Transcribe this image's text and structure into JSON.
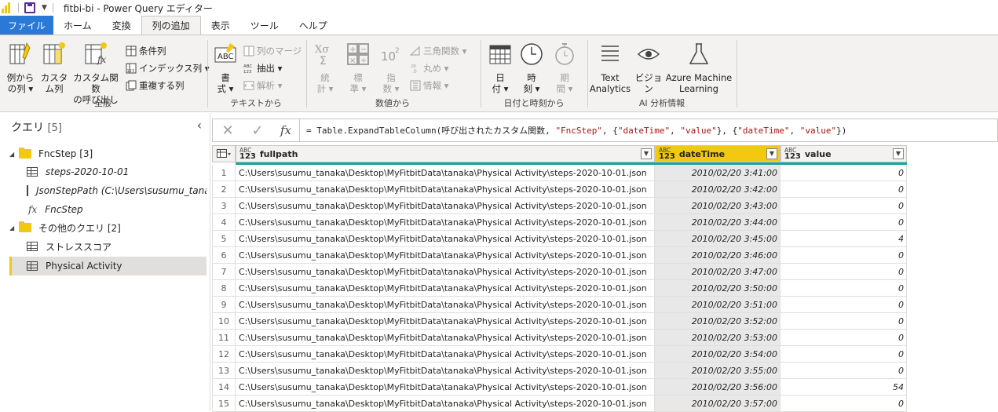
{
  "app": {
    "title": "fitbi-bi - Power Query エディター"
  },
  "tabs": [
    "ファイル",
    "ホーム",
    "変換",
    "列の追加",
    "表示",
    "ツール",
    "ヘルプ"
  ],
  "ribbon": {
    "general": {
      "label": "全般",
      "col_from_examples": [
        "例から",
        "の列 ▾"
      ],
      "custom_col": [
        "カスタ",
        "ム列"
      ],
      "invoke_custom_fn": [
        "カスタム関数",
        "の呼び出し"
      ],
      "conditional_col": "条件列",
      "index_col": "インデックス列 ▾",
      "duplicate_col": "重複する列"
    },
    "text": {
      "label": "テキストから",
      "format": [
        "書",
        "式 ▾"
      ],
      "merge_cols": "列のマージ",
      "extract": "抽出 ▾",
      "parse": "解析 ▾"
    },
    "number": {
      "label": "数値から",
      "statistics": [
        "統",
        "計 ▾"
      ],
      "standard": [
        "標",
        "準 ▾"
      ],
      "scientific": [
        "指",
        "数 ▾"
      ],
      "trig": "三角関数 ▾",
      "rounding": "丸め ▾",
      "information": "情報 ▾"
    },
    "datetime": {
      "label": "日付と時刻から",
      "date": [
        "日",
        "付 ▾"
      ],
      "time": [
        "時",
        "刻 ▾"
      ],
      "duration": [
        "期",
        "間 ▾"
      ]
    },
    "ai": {
      "label": "AI 分析情報",
      "text_analytics": [
        "Text",
        "Analytics"
      ],
      "vision": [
        "ビジョ",
        "ン"
      ],
      "azure_ml": [
        "Azure Machine",
        "Learning"
      ]
    }
  },
  "queries": {
    "header": "クエリ",
    "count": "[5]",
    "groups": [
      {
        "name": "FncStep [3]"
      },
      {
        "name": "その他のクエリ [2]"
      }
    ],
    "items": [
      "steps-2020-10-01",
      "JsonStepPath (C:\\Users\\susumu_tanaka",
      "FncStep",
      "ストレススコア",
      "Physical Activity"
    ]
  },
  "formula": {
    "prefix": "= Table.ExpandTableColumn(呼び出されたカスタム関数, ",
    "s1": "\"FncStep\"",
    "mid1": ", {",
    "s2": "\"dateTime\"",
    "mid2": ", ",
    "s3": "\"value\"",
    "mid3": "}, {",
    "s4": "\"dateTime\"",
    "mid4": ", ",
    "s5": "\"value\"",
    "suffix": "})"
  },
  "grid": {
    "columns": [
      {
        "name": "fullpath",
        "type_top": "ABC",
        "type_bottom": "123"
      },
      {
        "name": "dateTime",
        "type_top": "ABC",
        "type_bottom": "123"
      },
      {
        "name": "value",
        "type_top": "ABC",
        "type_bottom": "123"
      }
    ],
    "rows": [
      [
        "1",
        "C:\\Users\\susumu_tanaka\\Desktop\\MyFitbitData\\tanaka\\Physical Activity\\steps-2020-10-01.json",
        "2010/02/20 3:41:00",
        "0"
      ],
      [
        "2",
        "C:\\Users\\susumu_tanaka\\Desktop\\MyFitbitData\\tanaka\\Physical Activity\\steps-2020-10-01.json",
        "2010/02/20 3:42:00",
        "0"
      ],
      [
        "3",
        "C:\\Users\\susumu_tanaka\\Desktop\\MyFitbitData\\tanaka\\Physical Activity\\steps-2020-10-01.json",
        "2010/02/20 3:43:00",
        "0"
      ],
      [
        "4",
        "C:\\Users\\susumu_tanaka\\Desktop\\MyFitbitData\\tanaka\\Physical Activity\\steps-2020-10-01.json",
        "2010/02/20 3:44:00",
        "0"
      ],
      [
        "5",
        "C:\\Users\\susumu_tanaka\\Desktop\\MyFitbitData\\tanaka\\Physical Activity\\steps-2020-10-01.json",
        "2010/02/20 3:45:00",
        "4"
      ],
      [
        "6",
        "C:\\Users\\susumu_tanaka\\Desktop\\MyFitbitData\\tanaka\\Physical Activity\\steps-2020-10-01.json",
        "2010/02/20 3:46:00",
        "0"
      ],
      [
        "7",
        "C:\\Users\\susumu_tanaka\\Desktop\\MyFitbitData\\tanaka\\Physical Activity\\steps-2020-10-01.json",
        "2010/02/20 3:47:00",
        "0"
      ],
      [
        "8",
        "C:\\Users\\susumu_tanaka\\Desktop\\MyFitbitData\\tanaka\\Physical Activity\\steps-2020-10-01.json",
        "2010/02/20 3:50:00",
        "0"
      ],
      [
        "9",
        "C:\\Users\\susumu_tanaka\\Desktop\\MyFitbitData\\tanaka\\Physical Activity\\steps-2020-10-01.json",
        "2010/02/20 3:51:00",
        "0"
      ],
      [
        "10",
        "C:\\Users\\susumu_tanaka\\Desktop\\MyFitbitData\\tanaka\\Physical Activity\\steps-2020-10-01.json",
        "2010/02/20 3:52:00",
        "0"
      ],
      [
        "11",
        "C:\\Users\\susumu_tanaka\\Desktop\\MyFitbitData\\tanaka\\Physical Activity\\steps-2020-10-01.json",
        "2010/02/20 3:53:00",
        "0"
      ],
      [
        "12",
        "C:\\Users\\susumu_tanaka\\Desktop\\MyFitbitData\\tanaka\\Physical Activity\\steps-2020-10-01.json",
        "2010/02/20 3:54:00",
        "0"
      ],
      [
        "13",
        "C:\\Users\\susumu_tanaka\\Desktop\\MyFitbitData\\tanaka\\Physical Activity\\steps-2020-10-01.json",
        "2010/02/20 3:55:00",
        "0"
      ],
      [
        "14",
        "C:\\Users\\susumu_tanaka\\Desktop\\MyFitbitData\\tanaka\\Physical Activity\\steps-2020-10-01.json",
        "2010/02/20 3:56:00",
        "54"
      ],
      [
        "15",
        "C:\\Users\\susumu_tanaka\\Desktop\\MyFitbitData\\tanaka\\Physical Activity\\steps-2020-10-01.json",
        "2010/02/20 3:57:00",
        "0"
      ]
    ]
  },
  "colors": {
    "accent_yellow": "#f2c811",
    "file_tab_blue": "#2b79d6",
    "quality_bar_teal": "#1aa39c",
    "formula_string_red": "#a31515"
  }
}
